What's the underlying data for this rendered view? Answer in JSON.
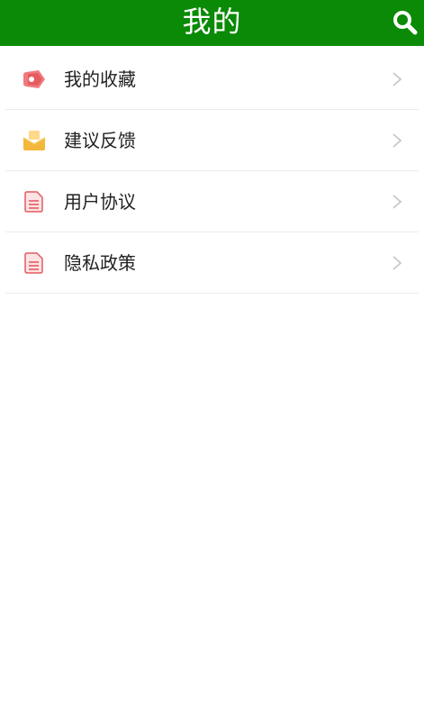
{
  "header": {
    "title": "我的",
    "background_color": "#0a8a06",
    "search_icon": "search-icon"
  },
  "menu": {
    "items": [
      {
        "label": "我的收藏",
        "icon": "favorite-tag-icon",
        "icon_color": "#e45b60"
      },
      {
        "label": "建议反馈",
        "icon": "envelope-icon",
        "icon_color": "#f3b73a"
      },
      {
        "label": "用户协议",
        "icon": "document-icon",
        "icon_color": "#e45b60"
      },
      {
        "label": "隐私政策",
        "icon": "document-icon",
        "icon_color": "#e45b60"
      }
    ],
    "chevron_icon": "chevron-right-icon"
  }
}
